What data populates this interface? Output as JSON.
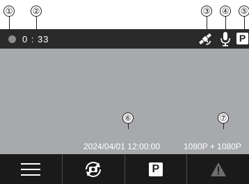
{
  "callouts": [
    "①",
    "②",
    "③",
    "④",
    "⑤",
    "⑥",
    "⑦"
  ],
  "status_bar": {
    "recording_time": "0 : 33",
    "icons": [
      "recording-status-dot",
      "gps-satellite-icon",
      "microphone-icon",
      "parking-mode-badge"
    ],
    "parking_badge": "P"
  },
  "info": {
    "datetime": "2024/04/01 12:00:00",
    "resolution": "1080P + 1080P"
  },
  "softkeys": [
    {
      "name": "menu",
      "icon": "menu-icon"
    },
    {
      "name": "camera-switch",
      "icon": "camera-switch-icon"
    },
    {
      "name": "parking",
      "icon": "parking-icon",
      "label": "P"
    },
    {
      "name": "event-record",
      "icon": "warning-icon"
    }
  ],
  "colors": {
    "screen_bg": "#a7a9ac",
    "top_bar": "#2a2a2b",
    "bottom_bar": "#1a1a1b",
    "rec_dot": "#8c8c8c"
  }
}
